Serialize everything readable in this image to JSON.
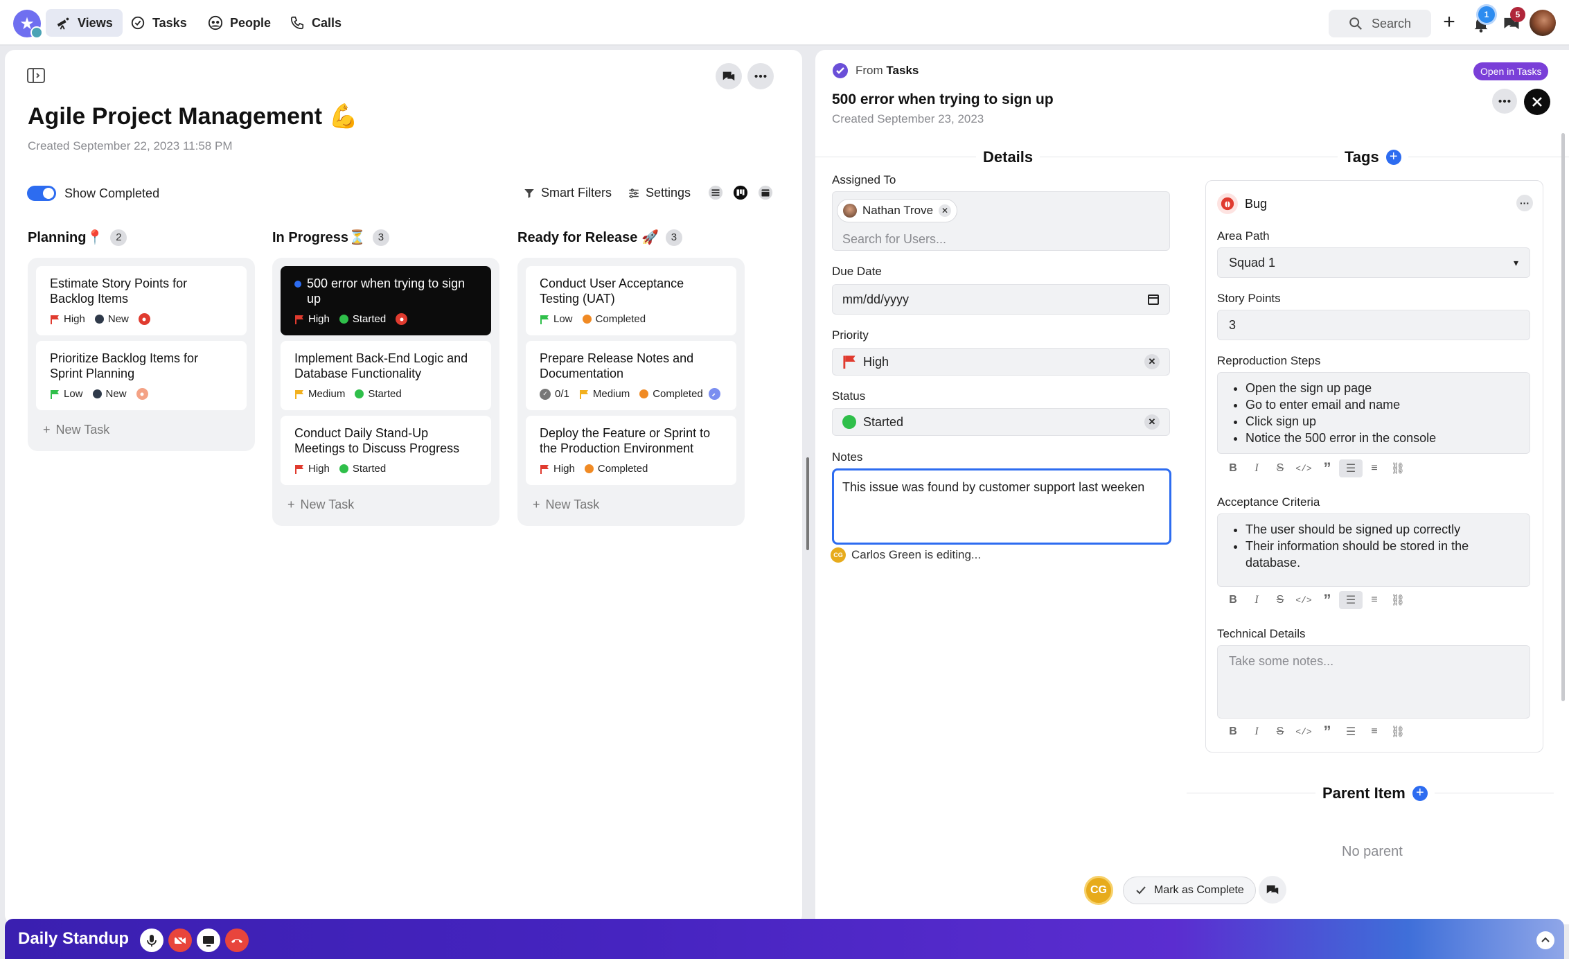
{
  "nav": {
    "tabs": [
      {
        "label": "Views",
        "icon": "telescope-icon"
      },
      {
        "label": "Tasks",
        "icon": "check-circle-icon"
      },
      {
        "label": "People",
        "icon": "people-icon"
      },
      {
        "label": "Calls",
        "icon": "phone-icon"
      }
    ],
    "search_label": "Search",
    "notifications_count": "1",
    "messages_count": "5"
  },
  "board": {
    "title": "Agile Project Management 💪",
    "created": "Created September 22, 2023 11:58 PM",
    "show_completed_label": "Show Completed",
    "show_completed": true,
    "smart_filters_label": "Smart Filters",
    "settings_label": "Settings",
    "new_task_label": "New Task",
    "columns": [
      {
        "name": "Planning",
        "emoji": "📍",
        "count": "2",
        "cards": [
          {
            "title": "Estimate Story Points for Backlog Items",
            "priority": "High",
            "status": "New"
          },
          {
            "title": "Prioritize Backlog Items for Sprint Planning",
            "priority": "Low",
            "status": "New"
          }
        ]
      },
      {
        "name": "In Progress",
        "emoji": "⏳",
        "count": "3",
        "cards": [
          {
            "title": "500 error when trying to sign up",
            "priority": "High",
            "status": "Started"
          },
          {
            "title": "Implement Back-End Logic and Database Functionality",
            "priority": "Medium",
            "status": "Started"
          },
          {
            "title": "Conduct Daily Stand-Up Meetings to Discuss Progress",
            "priority": "High",
            "status": "Started"
          }
        ]
      },
      {
        "name": "Ready for Release",
        "emoji": "🚀",
        "count": "3",
        "cards": [
          {
            "title": "Conduct User Acceptance Testing (UAT)",
            "priority": "Low",
            "status": "Completed"
          },
          {
            "title": "Prepare Release Notes and Documentation",
            "subtasks": "0/1",
            "priority": "Medium",
            "status": "Completed"
          },
          {
            "title": "Deploy the Feature or Sprint to the Production Environment",
            "priority": "High",
            "status": "Completed"
          }
        ]
      }
    ]
  },
  "detail": {
    "from_prefix": "From",
    "from_source": "Tasks",
    "open_in_tasks": "Open in Tasks",
    "title": "500 error when trying to sign up",
    "created": "Created September 23, 2023",
    "details_heading": "Details",
    "assigned_label": "Assigned To",
    "assignee": "Nathan Trove",
    "search_users_placeholder": "Search for Users...",
    "due_label": "Due Date",
    "due_value": "mm/dd/yyyy",
    "priority_label": "Priority",
    "priority_value": "High",
    "status_label": "Status",
    "status_value": "Started",
    "notes_label": "Notes",
    "notes_value": "This issue was found by customer support last weeken",
    "editing_text": "Carlos Green is editing...",
    "tags_heading": "Tags",
    "tag_name": "Bug",
    "area_label": "Area Path",
    "area_value": "Squad 1",
    "story_label": "Story Points",
    "story_value": "3",
    "repro_label": "Reproduction Steps",
    "repro_steps": [
      "Open the sign up page",
      "Go to enter email and name",
      "Click sign up",
      "Notice the 500 error in the console"
    ],
    "accept_label": "Acceptance Criteria",
    "accept_items": [
      "The user should be signed up correctly",
      "Their information should be stored in the database."
    ],
    "tech_label": "Technical Details",
    "tech_placeholder": "Take some notes...",
    "parent_heading": "Parent Item",
    "no_parent": "No parent",
    "avatar_initials": "CG",
    "mark_complete": "Mark as Complete"
  },
  "call": {
    "title": "Daily Standup"
  },
  "colors": {
    "accent": "#2d6cf0",
    "high": "#e03b2f",
    "medium": "#f2b01e",
    "low": "#2fbf4a",
    "started": "#2fbf4a",
    "completed": "#f08a24",
    "new": "#2f3a4a",
    "purple": "#7a3fd8"
  }
}
